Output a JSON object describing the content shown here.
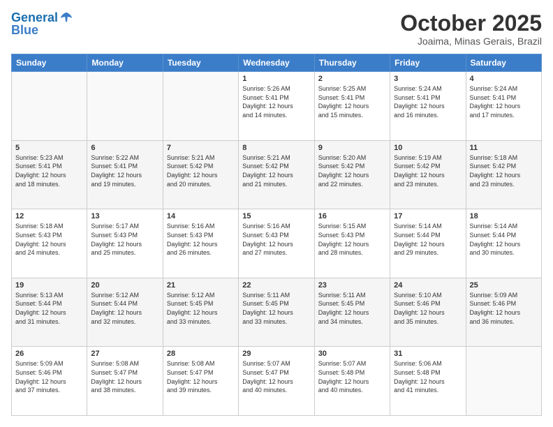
{
  "header": {
    "logo_line1": "General",
    "logo_line2": "Blue",
    "month": "October 2025",
    "location": "Joaima, Minas Gerais, Brazil"
  },
  "days_of_week": [
    "Sunday",
    "Monday",
    "Tuesday",
    "Wednesday",
    "Thursday",
    "Friday",
    "Saturday"
  ],
  "weeks": [
    [
      {
        "day": "",
        "info": ""
      },
      {
        "day": "",
        "info": ""
      },
      {
        "day": "",
        "info": ""
      },
      {
        "day": "1",
        "info": "Sunrise: 5:26 AM\nSunset: 5:41 PM\nDaylight: 12 hours\nand 14 minutes."
      },
      {
        "day": "2",
        "info": "Sunrise: 5:25 AM\nSunset: 5:41 PM\nDaylight: 12 hours\nand 15 minutes."
      },
      {
        "day": "3",
        "info": "Sunrise: 5:24 AM\nSunset: 5:41 PM\nDaylight: 12 hours\nand 16 minutes."
      },
      {
        "day": "4",
        "info": "Sunrise: 5:24 AM\nSunset: 5:41 PM\nDaylight: 12 hours\nand 17 minutes."
      }
    ],
    [
      {
        "day": "5",
        "info": "Sunrise: 5:23 AM\nSunset: 5:41 PM\nDaylight: 12 hours\nand 18 minutes."
      },
      {
        "day": "6",
        "info": "Sunrise: 5:22 AM\nSunset: 5:41 PM\nDaylight: 12 hours\nand 19 minutes."
      },
      {
        "day": "7",
        "info": "Sunrise: 5:21 AM\nSunset: 5:42 PM\nDaylight: 12 hours\nand 20 minutes."
      },
      {
        "day": "8",
        "info": "Sunrise: 5:21 AM\nSunset: 5:42 PM\nDaylight: 12 hours\nand 21 minutes."
      },
      {
        "day": "9",
        "info": "Sunrise: 5:20 AM\nSunset: 5:42 PM\nDaylight: 12 hours\nand 22 minutes."
      },
      {
        "day": "10",
        "info": "Sunrise: 5:19 AM\nSunset: 5:42 PM\nDaylight: 12 hours\nand 23 minutes."
      },
      {
        "day": "11",
        "info": "Sunrise: 5:18 AM\nSunset: 5:42 PM\nDaylight: 12 hours\nand 23 minutes."
      }
    ],
    [
      {
        "day": "12",
        "info": "Sunrise: 5:18 AM\nSunset: 5:43 PM\nDaylight: 12 hours\nand 24 minutes."
      },
      {
        "day": "13",
        "info": "Sunrise: 5:17 AM\nSunset: 5:43 PM\nDaylight: 12 hours\nand 25 minutes."
      },
      {
        "day": "14",
        "info": "Sunrise: 5:16 AM\nSunset: 5:43 PM\nDaylight: 12 hours\nand 26 minutes."
      },
      {
        "day": "15",
        "info": "Sunrise: 5:16 AM\nSunset: 5:43 PM\nDaylight: 12 hours\nand 27 minutes."
      },
      {
        "day": "16",
        "info": "Sunrise: 5:15 AM\nSunset: 5:43 PM\nDaylight: 12 hours\nand 28 minutes."
      },
      {
        "day": "17",
        "info": "Sunrise: 5:14 AM\nSunset: 5:44 PM\nDaylight: 12 hours\nand 29 minutes."
      },
      {
        "day": "18",
        "info": "Sunrise: 5:14 AM\nSunset: 5:44 PM\nDaylight: 12 hours\nand 30 minutes."
      }
    ],
    [
      {
        "day": "19",
        "info": "Sunrise: 5:13 AM\nSunset: 5:44 PM\nDaylight: 12 hours\nand 31 minutes."
      },
      {
        "day": "20",
        "info": "Sunrise: 5:12 AM\nSunset: 5:44 PM\nDaylight: 12 hours\nand 32 minutes."
      },
      {
        "day": "21",
        "info": "Sunrise: 5:12 AM\nSunset: 5:45 PM\nDaylight: 12 hours\nand 33 minutes."
      },
      {
        "day": "22",
        "info": "Sunrise: 5:11 AM\nSunset: 5:45 PM\nDaylight: 12 hours\nand 33 minutes."
      },
      {
        "day": "23",
        "info": "Sunrise: 5:11 AM\nSunset: 5:45 PM\nDaylight: 12 hours\nand 34 minutes."
      },
      {
        "day": "24",
        "info": "Sunrise: 5:10 AM\nSunset: 5:46 PM\nDaylight: 12 hours\nand 35 minutes."
      },
      {
        "day": "25",
        "info": "Sunrise: 5:09 AM\nSunset: 5:46 PM\nDaylight: 12 hours\nand 36 minutes."
      }
    ],
    [
      {
        "day": "26",
        "info": "Sunrise: 5:09 AM\nSunset: 5:46 PM\nDaylight: 12 hours\nand 37 minutes."
      },
      {
        "day": "27",
        "info": "Sunrise: 5:08 AM\nSunset: 5:47 PM\nDaylight: 12 hours\nand 38 minutes."
      },
      {
        "day": "28",
        "info": "Sunrise: 5:08 AM\nSunset: 5:47 PM\nDaylight: 12 hours\nand 39 minutes."
      },
      {
        "day": "29",
        "info": "Sunrise: 5:07 AM\nSunset: 5:47 PM\nDaylight: 12 hours\nand 40 minutes."
      },
      {
        "day": "30",
        "info": "Sunrise: 5:07 AM\nSunset: 5:48 PM\nDaylight: 12 hours\nand 40 minutes."
      },
      {
        "day": "31",
        "info": "Sunrise: 5:06 AM\nSunset: 5:48 PM\nDaylight: 12 hours\nand 41 minutes."
      },
      {
        "day": "",
        "info": ""
      }
    ]
  ]
}
